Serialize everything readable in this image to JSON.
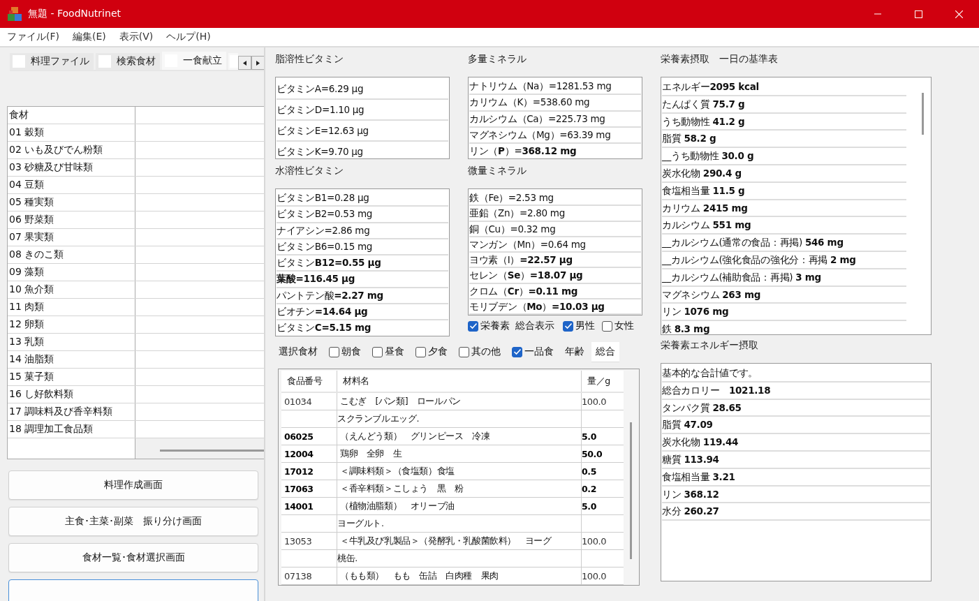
{
  "window": {
    "title": "無題 - FoodNutrinet"
  },
  "menu": [
    "ファイル(F)",
    "編集(E)",
    "表示(V)",
    "ヘルプ(H)"
  ],
  "left_tabs": [
    {
      "label": "料理ファイル",
      "selected": false
    },
    {
      "label": "検索食材",
      "selected": false
    },
    {
      "label": "一食献立",
      "selected": true
    }
  ],
  "food_groups": {
    "column": "食材",
    "rows": [
      "01 穀類",
      "02 いも及びでん粉類",
      "03 砂糖及び甘味類",
      "04 豆類",
      "05 種実類",
      "06 野菜類",
      "07 果実類",
      "08 きのこ類",
      "09 藻類",
      "10 魚介類",
      "11 肉類",
      "12 卵類",
      "13 乳類",
      "14 油脂類",
      "15 菓子類",
      "16 し好飲料類",
      "17 調味料及び香辛料類",
      "18 調理加工食品類"
    ]
  },
  "buttons": [
    "料理作成画面",
    "主食･主菜･副菜　振り分け画面",
    "食材一覧･食材選択画面"
  ],
  "fat_soluble_vitamins": {
    "title": "脂溶性ビタミン",
    "items": [
      "ビタミンA=6.29 μg",
      "ビタミンD=1.10 μg",
      "ビタミンE=12.63 μg",
      "ビタミンK=9.70 μg"
    ]
  },
  "macro_minerals": {
    "title": "多量ミネラル",
    "items": [
      "ナトリウム（Na）=1281.53 mg",
      "カリウム（K）=538.60 mg",
      "カルシウム（Ca）=225.73 mg",
      "マグネシウム（Mg）=63.39 mg",
      "リン（**P**）=**368.12 mg**"
    ]
  },
  "water_soluble_vitamins": {
    "title": "水溶性ビタミン",
    "items": [
      "ビタミンB1=0.28 μg",
      "ビタミンB2=0.53 mg",
      "ナイアシン=2.86 mg",
      "ビタミンB6=0.15 mg",
      "ビタミン**B12=0.55 μg**",
      "**葉酸=116.45 μg**",
      "パントテン酸**=2.27 mg**",
      "ビオチン**=14.64 μg**",
      "ビタミン**C=5.15 mg**"
    ]
  },
  "trace_minerals": {
    "title": "微量ミネラル",
    "items": [
      "鉄（Fe）=2.53 mg",
      "亜鉛（Zn）=2.80 mg",
      "銅（Cu）=0.32 mg",
      "マンガン（Mn）=0.64 mg",
      "ヨウ素（I）**=22.57 μg**",
      "セレン（**Se**）**=18.07 μg**",
      "クロム（**Cr**）**=0.11 mg**",
      "モリブデン（**Mo**）**=10.03 μg**"
    ]
  },
  "display_options": {
    "nutrient": {
      "label": "栄養素",
      "checked": true
    },
    "caption": "総合表示",
    "sexes": [
      {
        "label": "男性",
        "checked": true
      },
      {
        "label": "女性",
        "checked": false
      }
    ]
  },
  "selection_bar": {
    "label": "選択食材",
    "meals": [
      {
        "label": "朝食",
        "checked": false
      },
      {
        "label": "昼食",
        "checked": false
      },
      {
        "label": "夕食",
        "checked": false
      },
      {
        "label": "其の他",
        "checked": false
      },
      {
        "label": "一品食",
        "checked": true
      }
    ],
    "age_label": "年齢",
    "total_button": "総合"
  },
  "food_table": {
    "columns": [
      "食品番号",
      "材料名",
      "量／g"
    ],
    "rows": [
      {
        "kind": "food",
        "code": "01034",
        "name": "こむぎ　[パン類]　ロールパン",
        "amount": "100.0",
        "emphasized": false
      },
      {
        "kind": "dish",
        "name": "スクランブルエッグ."
      },
      {
        "kind": "food",
        "code": "06025",
        "name": "（えんどう類）　グリンピース　冷凍",
        "amount": "5.0",
        "emphasized": true
      },
      {
        "kind": "food",
        "code": "12004",
        "name": "鶏卵　全卵　生",
        "amount": "50.0",
        "emphasized": true
      },
      {
        "kind": "food",
        "code": "17012",
        "name": "＜調味料類＞（食塩類）食塩",
        "amount": "0.5",
        "emphasized": true
      },
      {
        "kind": "food",
        "code": "17063",
        "name": "＜香辛料類＞こしょう　黒　粉",
        "amount": "0.2",
        "emphasized": true
      },
      {
        "kind": "food",
        "code": "14001",
        "name": "（植物油脂類）　オリーブ油",
        "amount": "5.0",
        "emphasized": true
      },
      {
        "kind": "dish",
        "name": "ヨーグルト."
      },
      {
        "kind": "food",
        "code": "13053",
        "name": "＜牛乳及び乳製品＞（発酵乳・乳酸菌飲料）　ヨーグ",
        "amount": "100.0",
        "emphasized": false
      },
      {
        "kind": "dish",
        "name": "桃缶."
      },
      {
        "kind": "food",
        "code": "07138",
        "name": "（もも類）　もも　缶詰　白肉種　果肉",
        "amount": "100.0",
        "emphasized": false
      }
    ]
  },
  "daily_standard": {
    "title": "栄養素摂取　一日の基準表",
    "items": [
      "エネルギー**2095 kcal**",
      "たんぱく質 **75.7 g**",
      "うち動物性 **41.2 g**",
      "脂質 **58.2 g**",
      "__うち動物性 **30.0 g**",
      "炭水化物 **290.4 g**",
      "食塩相当量 **11.5 g**",
      "カリウム **2415 mg**",
      "カルシウム **551 mg**",
      "__カルシウム(通常の食品：再掲) **546 mg**",
      "__カルシウム(強化食品の強化分：再掲 **2 mg**",
      "__カルシウム(補助食品：再掲) **3 mg**",
      "マグネシウム **263 mg**",
      "リン **1076 mg**",
      "鉄 **8.3 mg**"
    ]
  },
  "energy_intake": {
    "title": "栄養素エネルギー摂取",
    "items": [
      "基本的な合計値です。",
      "総合カロリー　**1021.18**",
      "タンパク質 **28.65**",
      "脂質 **47.09**",
      "炭水化物 **119.44**",
      "糖質 **113.94**",
      "食塩相当量 **3.21**",
      "リン **368.12**",
      "水分 **260.27**"
    ]
  }
}
